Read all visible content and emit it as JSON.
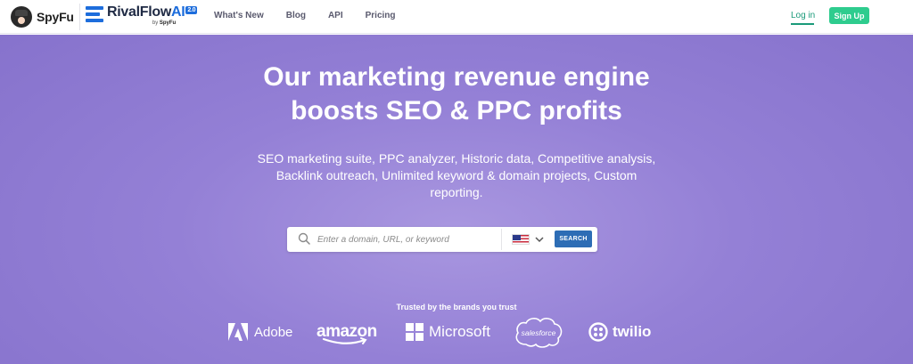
{
  "nav": {
    "spyfu_label": "SpyFu",
    "rivalflow_name": "RivalFlow",
    "rivalflow_ai": "AI",
    "rivalflow_version": "2.0",
    "rivalflow_by": "by",
    "rivalflow_by_brand": "SpyFu",
    "links": [
      "What's New",
      "Blog",
      "API",
      "Pricing"
    ],
    "login_label": "Log in",
    "signup_label": "Sign Up"
  },
  "hero": {
    "headline_line1": "Our marketing revenue engine",
    "headline_line2": "boosts SEO & PPC profits",
    "sub_line1": "SEO marketing suite, PPC analyzer, Historic data, Competitive analysis,",
    "sub_line2": "Backlink outreach, Unlimited keyword & domain projects, Custom",
    "sub_line3": "reporting."
  },
  "search": {
    "placeholder": "Enter a domain, URL, or keyword",
    "value": "",
    "country_icon": "us-flag-icon",
    "button_label": "SEARCH"
  },
  "brands": {
    "trusted_label": "Trusted by the brands you trust",
    "adobe": "Adobe",
    "amazon": "amazon",
    "microsoft": "Microsoft",
    "salesforce": "salesforce",
    "twilio": "twilio"
  },
  "colors": {
    "hero_bg": "#9480d6",
    "signup": "#2ecc8e",
    "login": "#1a9a7a",
    "search_button": "#2d6db5",
    "rivalflow_blue": "#1d6ddc"
  }
}
